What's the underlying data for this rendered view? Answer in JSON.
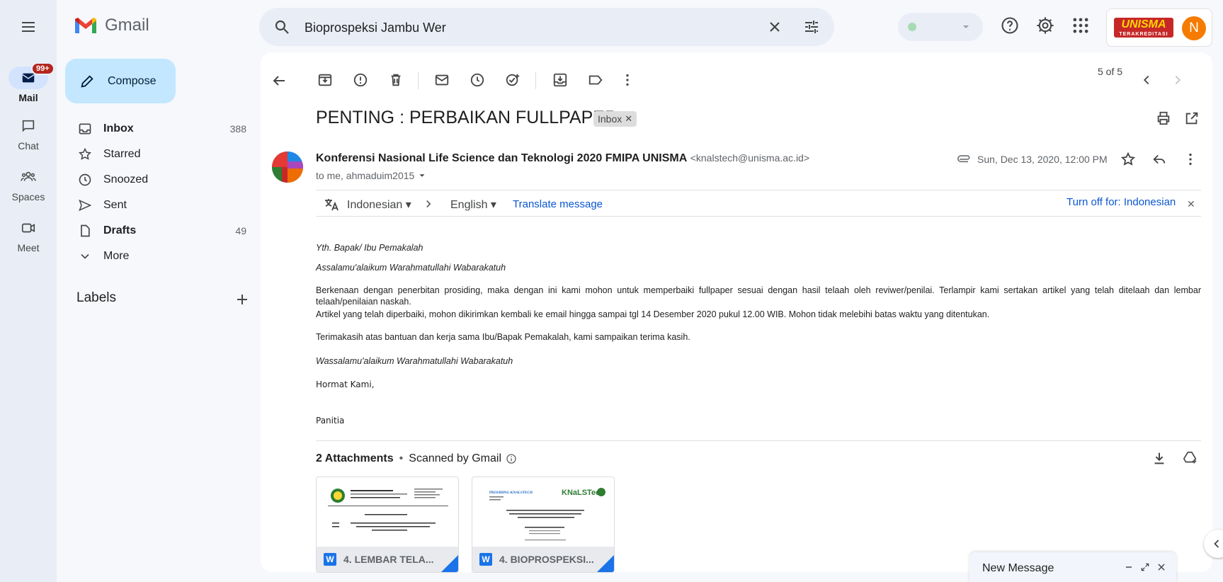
{
  "app": {
    "name": "Gmail"
  },
  "rail": {
    "mail_label": "Mail",
    "mail_badge": "99+",
    "chat_label": "Chat",
    "spaces_label": "Spaces",
    "meet_label": "Meet"
  },
  "nav": {
    "compose": "Compose",
    "items": [
      {
        "label": "Inbox",
        "count": "388"
      },
      {
        "label": "Starred",
        "count": ""
      },
      {
        "label": "Snoozed",
        "count": ""
      },
      {
        "label": "Sent",
        "count": ""
      },
      {
        "label": "Drafts",
        "count": "49"
      },
      {
        "label": "More",
        "count": ""
      }
    ],
    "labels_heading": "Labels"
  },
  "search": {
    "value": "Bioprospeksi Jambu Wer"
  },
  "brand": {
    "logo_text": "UNISMA",
    "logo_sub": "TERAKREDITASI",
    "avatar_letter": "N"
  },
  "toolbar": {
    "pager": "5 of 5"
  },
  "email": {
    "subject": "PENTING : PERBAIKAN FULLPAPER",
    "label_chip": "Inbox",
    "sender_name": "Konferensi Nasional Life Science dan Teknologi 2020 FMIPA UNISMA",
    "sender_email": "<knalstech@unisma.ac.id>",
    "to_line": "to me, ahmaduim2015",
    "date": "Sun, Dec 13, 2020, 12:00 PM"
  },
  "translate": {
    "from": "Indonesian",
    "to": "English",
    "action": "Translate message",
    "turn_off": "Turn off for: Indonesian"
  },
  "body": {
    "greeting": "Yth. Bapak/ Ibu Pemakalah",
    "salam": "Assalamu'alaikum Warahmatullahi Wabarakatuh",
    "p1": "Berkenaan dengan penerbitan prosiding, maka dengan ini kami mohon untuk memperbaiki fullpaper sesuai dengan hasil telaah oleh reviwer/penilai. Terlampir kami sertakan artikel yang telah ditelaah dan lembar telaah/penilaian naskah.",
    "p2": "Artikel yang telah diperbaiki, mohon dikirimkan kembali ke email hingga sampai tgl 14 Desember 2020 pukul 12.00 WIB. Mohon tidak melebihi batas waktu yang ditentukan.",
    "p3": "Terimakasih atas bantuan dan kerja sama Ibu/Bapak Pemakalah, kami sampaikan terima kasih.",
    "closing_salam": "Wassalamu'alaikum Warahmatullahi Wabarakatuh",
    "regards": "Hormat Kami,",
    "sign": "Panitia"
  },
  "attachments": {
    "count_label": "2 Attachments",
    "scanned": "Scanned by Gmail",
    "files": [
      {
        "name": "4. LEMBAR TELA...",
        "type_letter": "W"
      },
      {
        "name": "4. BIOPROSPEKSI...",
        "type_letter": "W"
      }
    ],
    "preview2_brand": "KNaLSTech",
    "preview2_header": "PROSIDING KNALSTECH"
  },
  "compose_window": {
    "title": "New Message"
  },
  "colors": {
    "accent": "#0b57d0",
    "compose_bg": "#c2e7ff",
    "badge": "#b3261e",
    "avatar": "#f57c00"
  }
}
